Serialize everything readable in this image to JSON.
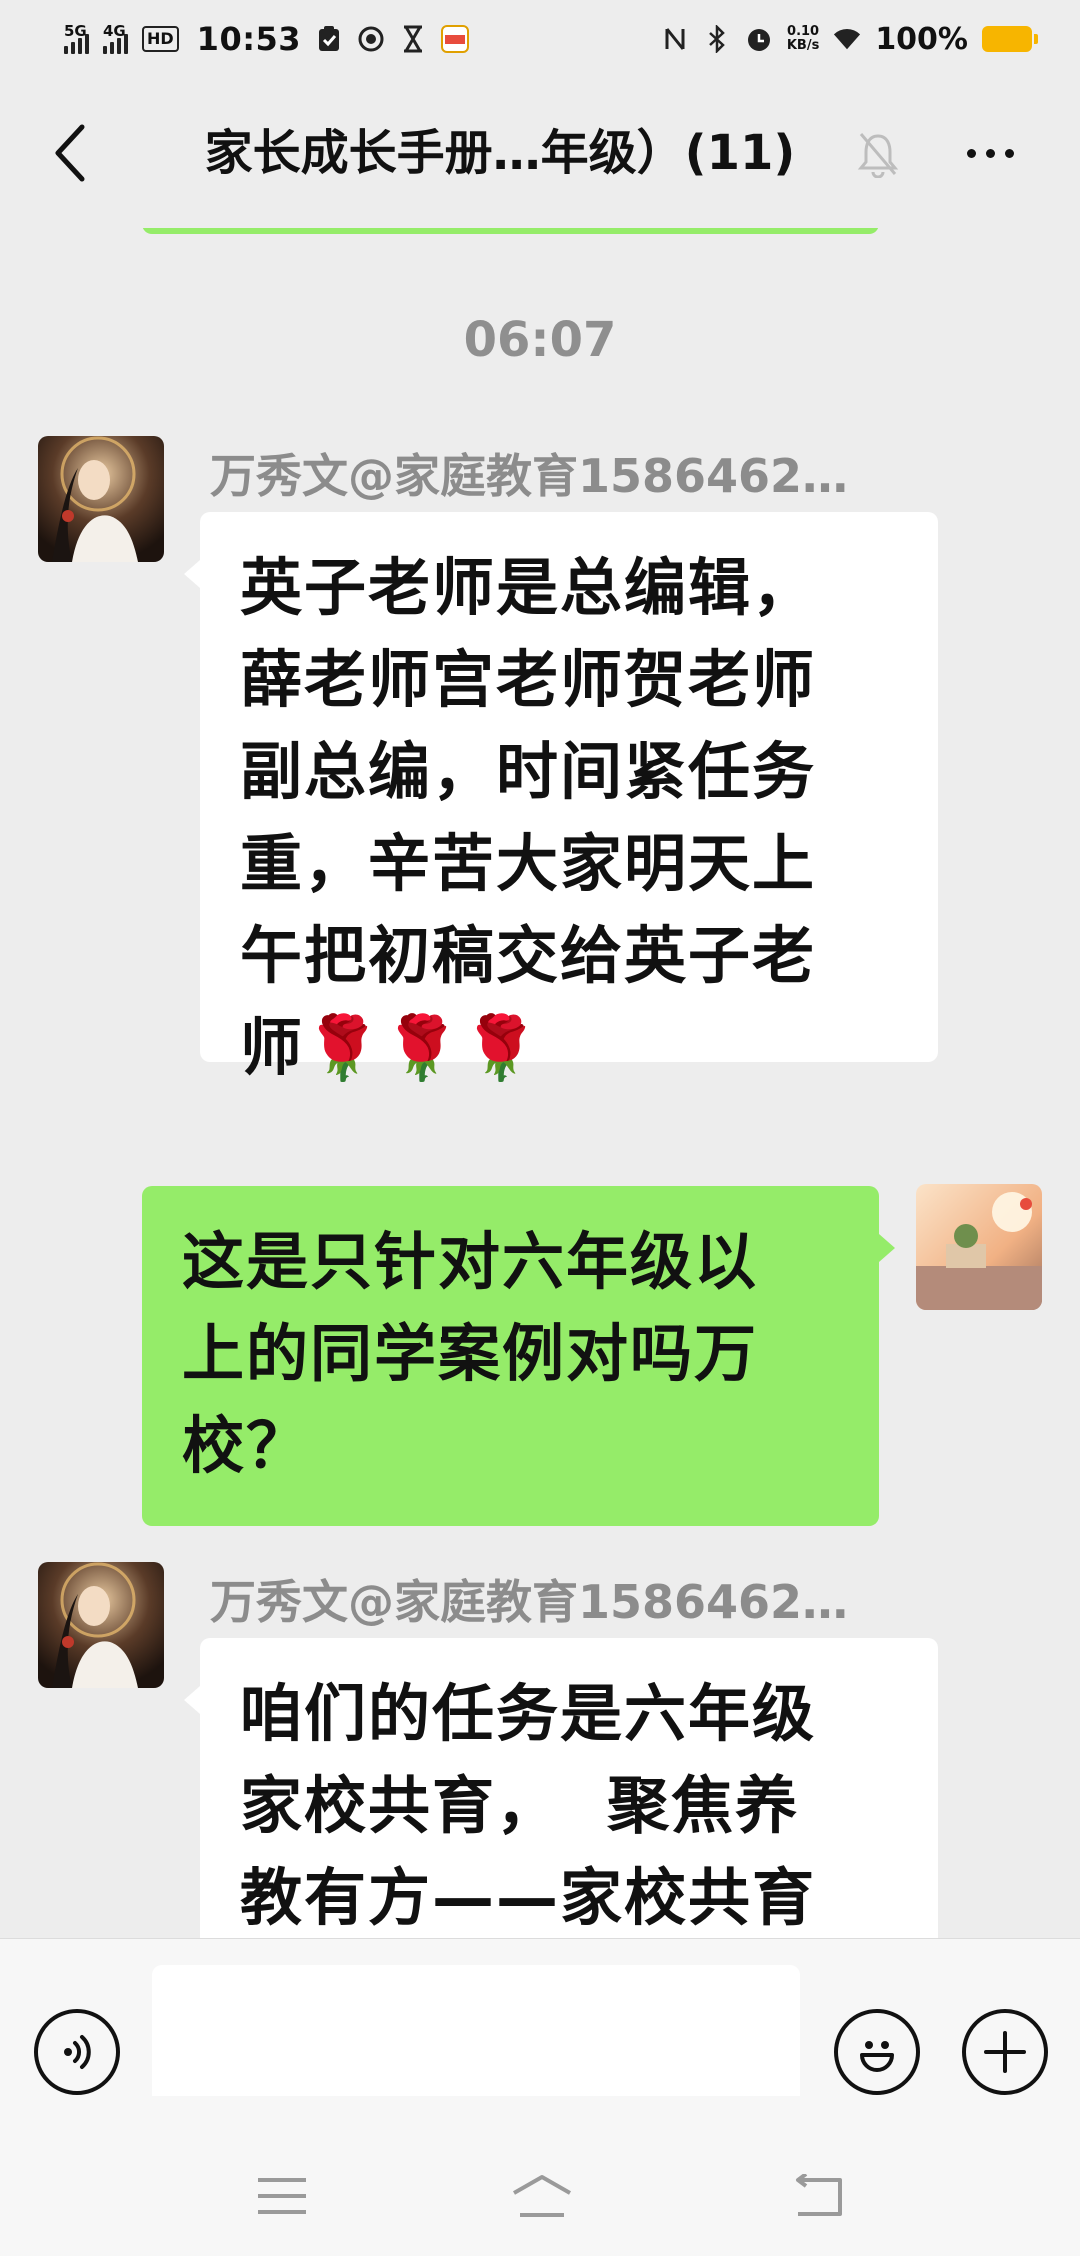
{
  "status_bar": {
    "signal1_label": "5G",
    "signal2_label": "4G",
    "hd_label": "HD",
    "time": "10:53",
    "net_speed_value": "0.10",
    "net_speed_unit": "KB/s",
    "battery_percent": "100%"
  },
  "nav": {
    "title": "家长成长手册…年级）(11)"
  },
  "chat": {
    "timestamp": "06:07",
    "messages": [
      {
        "sender": "万秀文@家庭教育1586462…",
        "direction": "in",
        "lines": [
          "英子老师是总编辑，",
          "薛老师宫老师贺老师",
          "副总编，时间紧任务",
          "重，辛苦大家明天上",
          "午把初稿交给英子老",
          "师🌹🌹🌹"
        ]
      },
      {
        "direction": "out",
        "lines": [
          "这是只针对六年级以",
          "上的同学案例对吗万",
          "校？"
        ]
      },
      {
        "sender": "万秀文@家庭教育1586462…",
        "direction": "in",
        "lines": [
          "咱们的任务是六年级",
          "家校共育，  聚焦养",
          "教有方——家校共育"
        ]
      }
    ]
  },
  "input": {
    "value": ""
  },
  "colors": {
    "background": "#ededed",
    "outgoing_bubble": "#95ec69",
    "incoming_bubble": "#ffffff",
    "battery": "#f7b500"
  }
}
